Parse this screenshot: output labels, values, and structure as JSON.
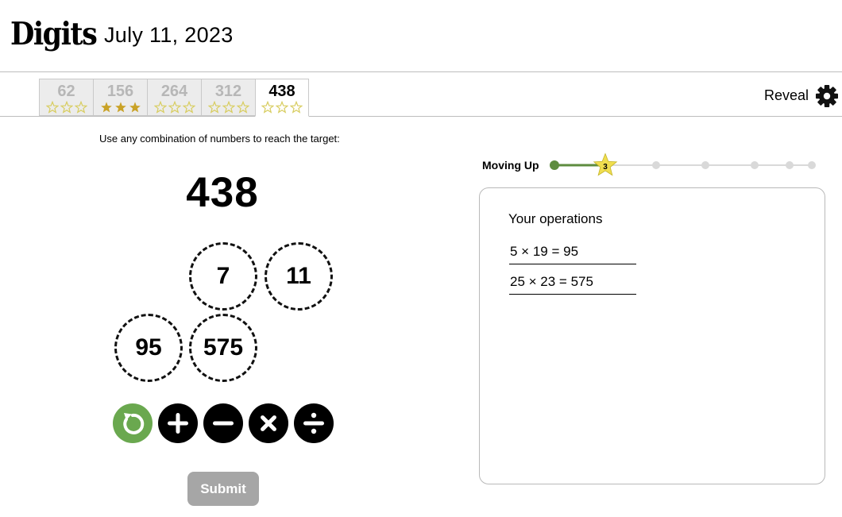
{
  "header": {
    "logo": "Digits",
    "date": "July 11, 2023"
  },
  "tabs": [
    {
      "number": "62",
      "stars": 0,
      "active": false
    },
    {
      "number": "156",
      "stars": 3,
      "active": false
    },
    {
      "number": "264",
      "stars": 0,
      "active": false
    },
    {
      "number": "312",
      "stars": 0,
      "active": false
    },
    {
      "number": "438",
      "stars": 0,
      "active": true
    }
  ],
  "toolbar": {
    "reveal_label": "Reveal",
    "settings_icon": "gear-icon"
  },
  "game": {
    "instruction": "Use any combination of numbers to reach the target:",
    "target": "438",
    "numbers": [
      "7",
      "11",
      "95",
      "575"
    ],
    "operations": [
      {
        "name": "undo",
        "icon": "undo-icon"
      },
      {
        "name": "add",
        "icon": "plus-icon"
      },
      {
        "name": "subtract",
        "icon": "minus-icon"
      },
      {
        "name": "multiply",
        "icon": "times-icon"
      },
      {
        "name": "divide",
        "icon": "divide-icon"
      }
    ],
    "submit_label": "Submit"
  },
  "progress": {
    "rank_label": "Moving Up",
    "current_step_label": "3",
    "total_steps": 7,
    "current_step": 2
  },
  "operations_panel": {
    "title": "Your operations",
    "entries": [
      "5 × 19 = 95",
      "25 × 23 = 575"
    ]
  },
  "colors": {
    "star_filled": "#c9a227",
    "star_outline": "#d8cd60",
    "progress_fill": "#5e8c3f",
    "progress_track": "#d9d9d9",
    "current_star": "#f0de4f",
    "undo_button": "#6aa84f",
    "submit_disabled": "#a6a6a6"
  }
}
